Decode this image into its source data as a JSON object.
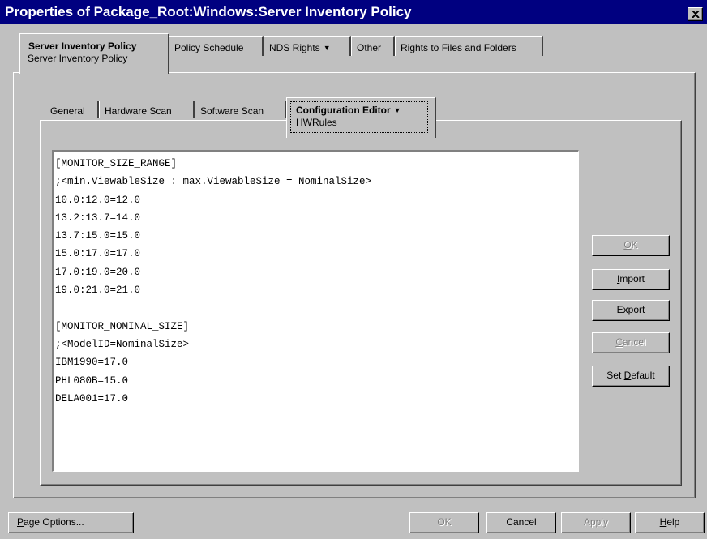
{
  "window": {
    "title": "Properties of Package_Root:Windows:Server Inventory Policy"
  },
  "top_tabs": [
    {
      "label": "Server Inventory Policy",
      "sub": "Server Inventory Policy",
      "active": true
    },
    {
      "label": "Policy Schedule"
    },
    {
      "label": "NDS Rights",
      "dropdown": true
    },
    {
      "label": "Other"
    },
    {
      "label": "Rights to Files and Folders"
    }
  ],
  "inner_tabs": [
    {
      "label": "General"
    },
    {
      "label": "Hardware Scan"
    },
    {
      "label": "Software Scan"
    },
    {
      "label": "Configuration Editor",
      "sub": "HWRules",
      "active": true,
      "dropdown": true
    }
  ],
  "editor_lines": [
    "[MONITOR_SIZE_RANGE]",
    ";<min.ViewableSize : max.ViewableSize = NominalSize>",
    "10.0:12.0=12.0",
    "13.2:13.7=14.0",
    "13.7:15.0=15.0",
    "15.0:17.0=17.0",
    "17.0:19.0=20.0",
    "19.0:21.0=21.0",
    "",
    "[MONITOR_NOMINAL_SIZE]",
    ";<ModelID=NominalSize>",
    "IBM1990=17.0",
    "PHL080B=15.0",
    "DELA001=17.0"
  ],
  "side_buttons": {
    "ok": {
      "pre": "",
      "mnemonic": "O",
      "post": "K",
      "disabled": true
    },
    "import": {
      "pre": "",
      "mnemonic": "I",
      "post": "mport",
      "disabled": false
    },
    "export": {
      "pre": "",
      "mnemonic": "E",
      "post": "xport",
      "disabled": false
    },
    "cancel": {
      "pre": "",
      "mnemonic": "C",
      "post": "ancel",
      "disabled": true
    },
    "set_default": {
      "pre": "Set ",
      "mnemonic": "D",
      "post": "efault",
      "disabled": false
    }
  },
  "bottom_buttons": {
    "page_options": {
      "pre": "",
      "mnemonic": "P",
      "post": "age Options..."
    },
    "ok": "OK",
    "cancel": "Cancel",
    "apply": "Apply",
    "help": {
      "pre": "",
      "mnemonic": "H",
      "post": "elp"
    }
  },
  "icons": {
    "dropdown": "triangle-down-icon",
    "close": "close-icon"
  }
}
